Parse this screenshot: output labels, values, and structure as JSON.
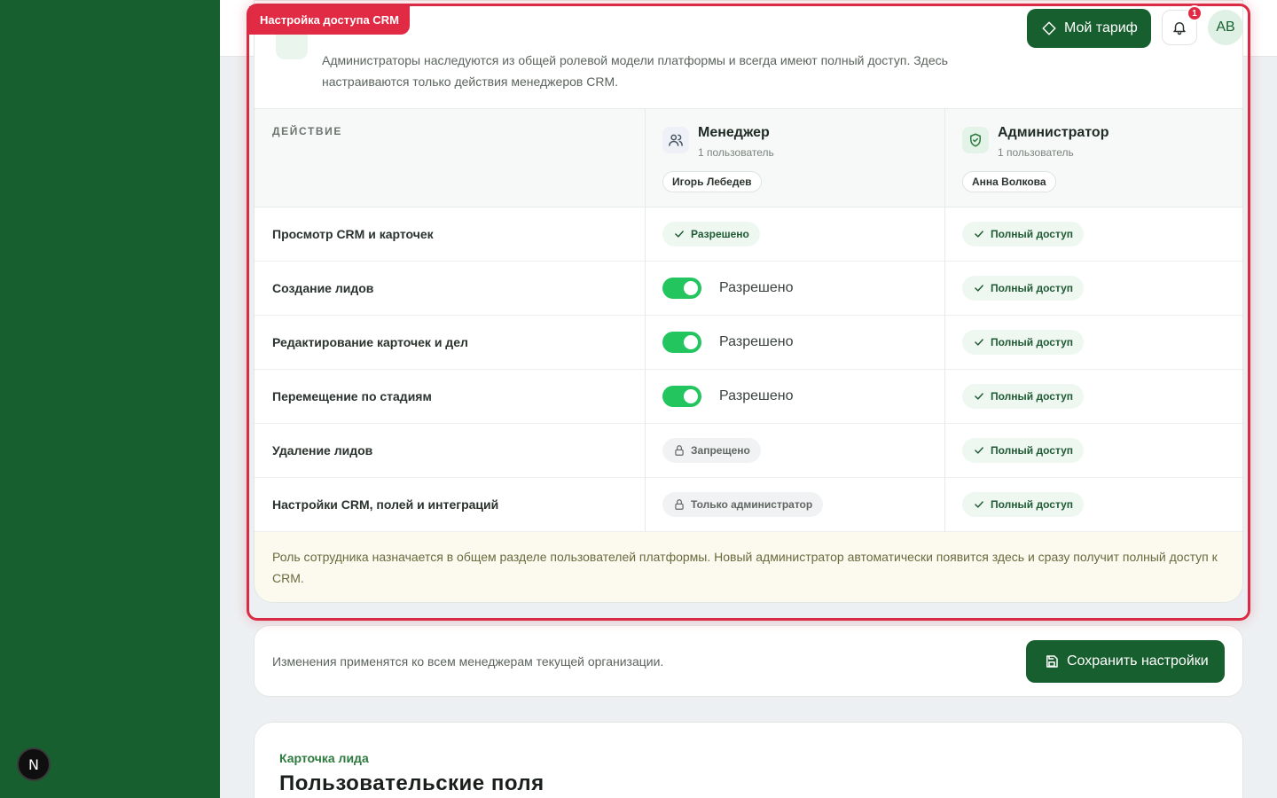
{
  "sidebar": {
    "badge_letter": "N"
  },
  "topbar": {
    "plan_button": "Мой тариф",
    "notification_count": "1",
    "avatar_initials": "AB"
  },
  "highlight_label": "Настройка доступа CRM",
  "intro": {
    "text": "Администраторы наследуются из общей ролевой модели платформы и всегда имеют полный доступ. Здесь настраиваются только действия менеджеров CRM."
  },
  "table": {
    "action_header": "ДЕЙСТВИЕ",
    "roles": [
      {
        "title": "Менеджер",
        "count": "1 пользователь",
        "user": "Игорь Лебедев",
        "icon": "users-icon"
      },
      {
        "title": "Администратор",
        "count": "1 пользователь",
        "user": "Анна Волкова",
        "icon": "shield-check-icon"
      }
    ],
    "rows": [
      {
        "label": "Просмотр CRM и карточек",
        "manager": "Разрешено",
        "manager_type": "pill-ok",
        "admin": "Полный доступ"
      },
      {
        "label": "Создание лидов",
        "manager": "Разрешено",
        "manager_type": "toggle",
        "admin": "Полный доступ"
      },
      {
        "label": "Редактирование карточек и дел",
        "manager": "Разрешено",
        "manager_type": "toggle",
        "admin": "Полный доступ"
      },
      {
        "label": "Перемещение по стадиям",
        "manager": "Разрешено",
        "manager_type": "toggle",
        "admin": "Полный доступ"
      },
      {
        "label": "Удаление лидов",
        "manager": "Запрещено",
        "manager_type": "pill-lock",
        "admin": "Полный доступ"
      },
      {
        "label": "Настройки CRM, полей и интеграций",
        "manager": "Только администратор",
        "manager_type": "pill-lock",
        "admin": "Полный доступ"
      }
    ],
    "note": "Роль сотрудника назначается в общем разделе пользователей платформы. Новый администратор автоматически появится здесь и сразу получит полный доступ к CRM."
  },
  "save": {
    "note": "Изменения применятся ко всем менеджерам текущей организации.",
    "button": "Сохранить настройки"
  },
  "lead_card": {
    "kicker": "Карточка лида",
    "title": "Пользовательские поля"
  },
  "colors": {
    "brand": "#185f2f",
    "toggle_on": "#22c55e",
    "highlight": "#d92b43"
  }
}
